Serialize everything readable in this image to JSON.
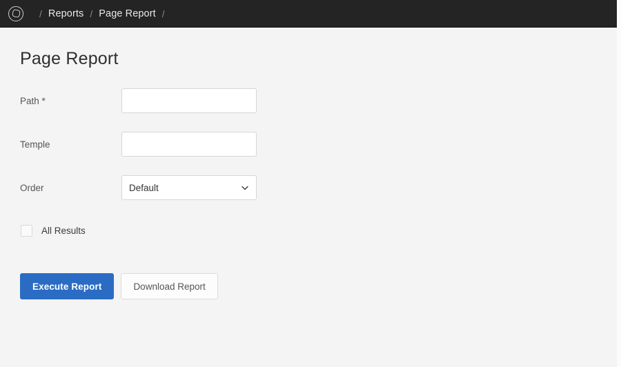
{
  "topbar": {
    "logo_icon": "app-logo-icon",
    "breadcrumb": {
      "separator": "/",
      "items": [
        {
          "label": "Reports"
        },
        {
          "label": "Page Report"
        }
      ]
    }
  },
  "main": {
    "page_title": "Page Report",
    "form": {
      "fields": [
        {
          "label": "Path *",
          "value": "",
          "placeholder": "",
          "type": "text"
        },
        {
          "label": "Temple",
          "value": "",
          "placeholder": "",
          "type": "text"
        }
      ],
      "order": {
        "label": "Order",
        "selected": "Default",
        "options": [
          "Default"
        ],
        "chevron_icon": "chevron-down-icon"
      },
      "all_results": {
        "label": "All Results",
        "checked": false
      }
    },
    "buttons": {
      "execute_label": "Execute Report",
      "download_label": "Download Report"
    }
  },
  "colors": {
    "topbar_bg": "#242424",
    "page_bg": "#f4f4f4",
    "primary": "#2a6cc4",
    "input_border": "#d6d6d6",
    "label_text": "#555555",
    "title_text": "#2e2e2e",
    "crumb_text": "#e8e8e8",
    "crumb_sep": "#8a8a8a"
  }
}
